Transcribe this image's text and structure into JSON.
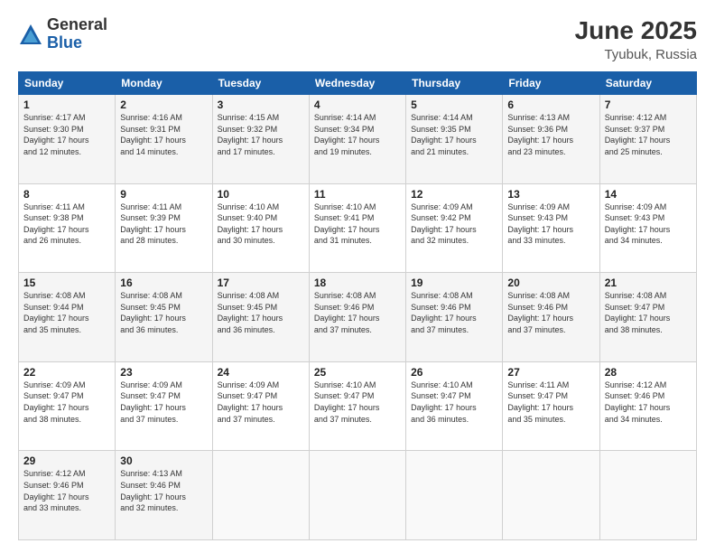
{
  "logo": {
    "general": "General",
    "blue": "Blue"
  },
  "title": "June 2025",
  "location": "Tyubuk, Russia",
  "days_header": [
    "Sunday",
    "Monday",
    "Tuesday",
    "Wednesday",
    "Thursday",
    "Friday",
    "Saturday"
  ],
  "weeks": [
    [
      {
        "day": "1",
        "info": "Sunrise: 4:17 AM\nSunset: 9:30 PM\nDaylight: 17 hours\nand 12 minutes."
      },
      {
        "day": "2",
        "info": "Sunrise: 4:16 AM\nSunset: 9:31 PM\nDaylight: 17 hours\nand 14 minutes."
      },
      {
        "day": "3",
        "info": "Sunrise: 4:15 AM\nSunset: 9:32 PM\nDaylight: 17 hours\nand 17 minutes."
      },
      {
        "day": "4",
        "info": "Sunrise: 4:14 AM\nSunset: 9:34 PM\nDaylight: 17 hours\nand 19 minutes."
      },
      {
        "day": "5",
        "info": "Sunrise: 4:14 AM\nSunset: 9:35 PM\nDaylight: 17 hours\nand 21 minutes."
      },
      {
        "day": "6",
        "info": "Sunrise: 4:13 AM\nSunset: 9:36 PM\nDaylight: 17 hours\nand 23 minutes."
      },
      {
        "day": "7",
        "info": "Sunrise: 4:12 AM\nSunset: 9:37 PM\nDaylight: 17 hours\nand 25 minutes."
      }
    ],
    [
      {
        "day": "8",
        "info": "Sunrise: 4:11 AM\nSunset: 9:38 PM\nDaylight: 17 hours\nand 26 minutes."
      },
      {
        "day": "9",
        "info": "Sunrise: 4:11 AM\nSunset: 9:39 PM\nDaylight: 17 hours\nand 28 minutes."
      },
      {
        "day": "10",
        "info": "Sunrise: 4:10 AM\nSunset: 9:40 PM\nDaylight: 17 hours\nand 30 minutes."
      },
      {
        "day": "11",
        "info": "Sunrise: 4:10 AM\nSunset: 9:41 PM\nDaylight: 17 hours\nand 31 minutes."
      },
      {
        "day": "12",
        "info": "Sunrise: 4:09 AM\nSunset: 9:42 PM\nDaylight: 17 hours\nand 32 minutes."
      },
      {
        "day": "13",
        "info": "Sunrise: 4:09 AM\nSunset: 9:43 PM\nDaylight: 17 hours\nand 33 minutes."
      },
      {
        "day": "14",
        "info": "Sunrise: 4:09 AM\nSunset: 9:43 PM\nDaylight: 17 hours\nand 34 minutes."
      }
    ],
    [
      {
        "day": "15",
        "info": "Sunrise: 4:08 AM\nSunset: 9:44 PM\nDaylight: 17 hours\nand 35 minutes."
      },
      {
        "day": "16",
        "info": "Sunrise: 4:08 AM\nSunset: 9:45 PM\nDaylight: 17 hours\nand 36 minutes."
      },
      {
        "day": "17",
        "info": "Sunrise: 4:08 AM\nSunset: 9:45 PM\nDaylight: 17 hours\nand 36 minutes."
      },
      {
        "day": "18",
        "info": "Sunrise: 4:08 AM\nSunset: 9:46 PM\nDaylight: 17 hours\nand 37 minutes."
      },
      {
        "day": "19",
        "info": "Sunrise: 4:08 AM\nSunset: 9:46 PM\nDaylight: 17 hours\nand 37 minutes."
      },
      {
        "day": "20",
        "info": "Sunrise: 4:08 AM\nSunset: 9:46 PM\nDaylight: 17 hours\nand 37 minutes."
      },
      {
        "day": "21",
        "info": "Sunrise: 4:08 AM\nSunset: 9:47 PM\nDaylight: 17 hours\nand 38 minutes."
      }
    ],
    [
      {
        "day": "22",
        "info": "Sunrise: 4:09 AM\nSunset: 9:47 PM\nDaylight: 17 hours\nand 38 minutes."
      },
      {
        "day": "23",
        "info": "Sunrise: 4:09 AM\nSunset: 9:47 PM\nDaylight: 17 hours\nand 37 minutes."
      },
      {
        "day": "24",
        "info": "Sunrise: 4:09 AM\nSunset: 9:47 PM\nDaylight: 17 hours\nand 37 minutes."
      },
      {
        "day": "25",
        "info": "Sunrise: 4:10 AM\nSunset: 9:47 PM\nDaylight: 17 hours\nand 37 minutes."
      },
      {
        "day": "26",
        "info": "Sunrise: 4:10 AM\nSunset: 9:47 PM\nDaylight: 17 hours\nand 36 minutes."
      },
      {
        "day": "27",
        "info": "Sunrise: 4:11 AM\nSunset: 9:47 PM\nDaylight: 17 hours\nand 35 minutes."
      },
      {
        "day": "28",
        "info": "Sunrise: 4:12 AM\nSunset: 9:46 PM\nDaylight: 17 hours\nand 34 minutes."
      }
    ],
    [
      {
        "day": "29",
        "info": "Sunrise: 4:12 AM\nSunset: 9:46 PM\nDaylight: 17 hours\nand 33 minutes."
      },
      {
        "day": "30",
        "info": "Sunrise: 4:13 AM\nSunset: 9:46 PM\nDaylight: 17 hours\nand 32 minutes."
      },
      {
        "day": "",
        "info": ""
      },
      {
        "day": "",
        "info": ""
      },
      {
        "day": "",
        "info": ""
      },
      {
        "day": "",
        "info": ""
      },
      {
        "day": "",
        "info": ""
      }
    ]
  ]
}
